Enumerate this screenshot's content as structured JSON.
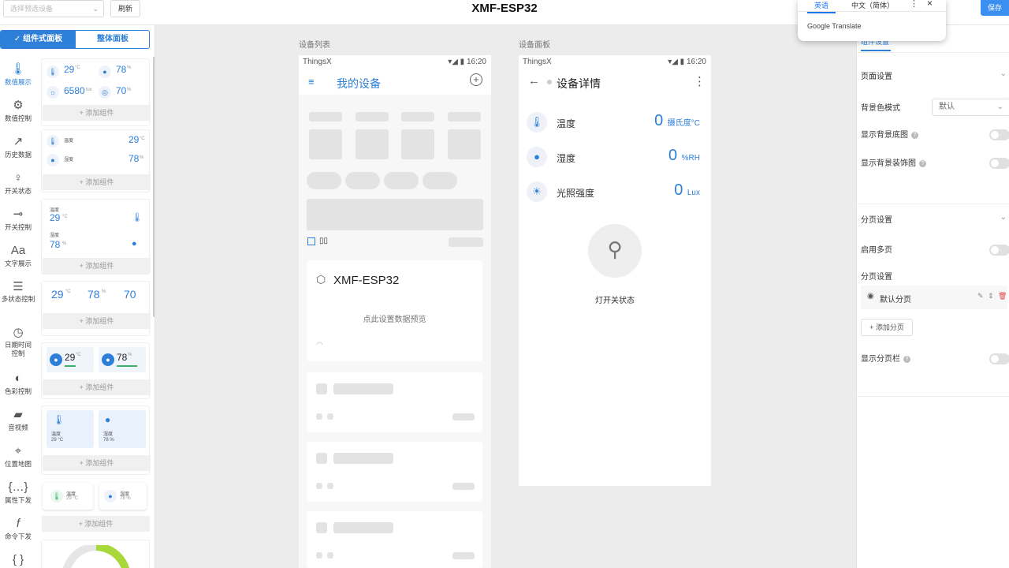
{
  "topbar": {
    "device_placeholder": "选择预选设备",
    "refresh": "刷新",
    "title": "XMF-ESP32",
    "save": "保存"
  },
  "translate": {
    "tab1": "英语",
    "tab2": "中文（简体）",
    "brand": "Google Translate"
  },
  "left": {
    "seg1": "✓ 组件式面板",
    "seg2": "整体面板",
    "categories": [
      "数值展示",
      "数值控制",
      "历史数据",
      "开关状态",
      "开关控制",
      "文字展示",
      "多状态控制",
      "日期时间控制",
      "色彩控制",
      "音视频",
      "位置地图",
      "属性下发",
      "命令下发"
    ],
    "add_label": "+ 添加组件",
    "w1": {
      "v1": "29",
      "u1": "°C",
      "v2": "78",
      "u2": "%",
      "v3": "6580",
      "u3": "lux",
      "v4": "70",
      "u4": "%"
    },
    "w2": {
      "l1": "温度",
      "l2": "湿度",
      "v1": "29",
      "u1": "°C",
      "v2": "78",
      "u2": "%"
    },
    "w3": {
      "l1": "温度",
      "v1": "29",
      "u1": "°C",
      "l2": "湿度",
      "v2": "78",
      "u2": "%"
    },
    "w4": {
      "v1": "29",
      "u1": "°C",
      "v2": "78",
      "u2": "%",
      "v3": "70"
    },
    "w5": {
      "v1": "29",
      "u1": "°C",
      "v2": "78",
      "u2": "%"
    },
    "w6": {
      "l1": "温度",
      "s1": "29 °C",
      "l2": "湿度",
      "s2": "78 %"
    },
    "w7": {
      "l1": "温度",
      "s1": "29 °C",
      "l2": "湿度",
      "s2": "78 %"
    }
  },
  "middle": {
    "label_list": "设备列表",
    "label_panel": "设备面板",
    "status_app": "ThingsX",
    "status_time": "16:20",
    "my_devices": "我的设备",
    "grid_label": "▯▯",
    "device_name": "XMF-ESP32",
    "device_hint": "点此设置数据预览",
    "detail_title": "设备详情",
    "readings": [
      {
        "label": "温度",
        "value": "0",
        "unit": "摄氏度°C"
      },
      {
        "label": "湿度",
        "value": "0",
        "unit": "%RH"
      },
      {
        "label": "光照强度",
        "value": "0",
        "unit": "Lux"
      }
    ],
    "lamp_label": "灯开关状态"
  },
  "right": {
    "tab": "组件设置",
    "page_settings": "页面设置",
    "bg_mode": "背景色模式",
    "bg_mode_value": "默认",
    "show_bg_img": "显示背景底图",
    "show_bg_deco": "显示背景装饰图",
    "paging": "分页设置",
    "enable_multi": "启用多页",
    "paging_sub": "分页设置",
    "default_page": "默认分页",
    "add_page": "+ 添加分页",
    "show_pagebar": "显示分页栏"
  }
}
